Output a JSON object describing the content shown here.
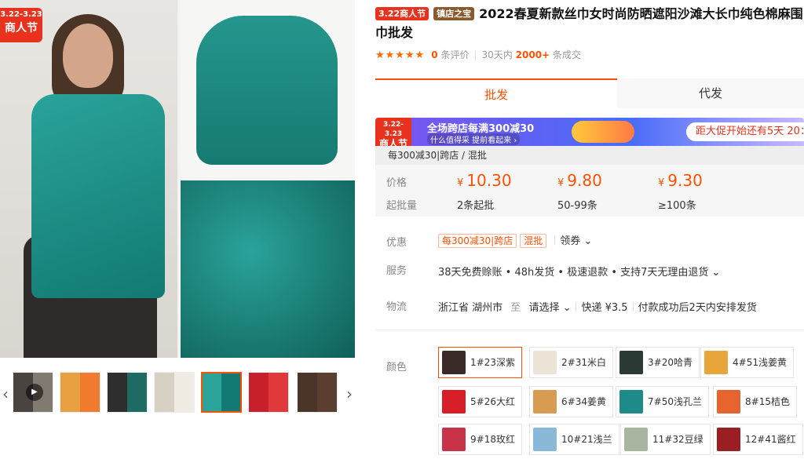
{
  "gallery": {
    "badge_date": "3.22-3.23",
    "badge_name": "商人节",
    "thumbs": [
      {
        "icon": "video-play-icon",
        "colors": [
          "#4a4440",
          "#807a70"
        ]
      },
      {
        "colors": [
          "#e8a040",
          "#f07a2e"
        ]
      },
      {
        "colors": [
          "#2e2e2e",
          "#1d6b63"
        ]
      },
      {
        "colors": [
          "#d8d0c2",
          "#f0ece4"
        ]
      },
      {
        "colors": [
          "#2aa39a",
          "#127a72"
        ]
      },
      {
        "colors": [
          "#c8202a",
          "#e23a3a"
        ]
      },
      {
        "colors": [
          "#4b3428",
          "#5a3e30"
        ]
      }
    ],
    "prev_arrow": "‹",
    "next_arrow": "›",
    "play_glyph": "▶"
  },
  "product": {
    "tag_festival": "3.22商人节",
    "tag_store": "镇店之宝",
    "title": "2022春夏新款丝巾女时尚防晒遮阳沙滩大长巾纯色棉麻围巾批发",
    "stars": "★★★★★",
    "reviews_count": "0",
    "reviews_label": "条评价",
    "period_label": "30天内",
    "sales_count": "2000+",
    "sales_label": "条成交"
  },
  "tabs": {
    "wholesale": "批发",
    "dropship": "代发"
  },
  "promo": {
    "badge_date": "3.22-3.23",
    "badge_name": "商人节",
    "headline": "全场跨店每满300减30",
    "subline": "什么值得采 提前看起来 ›",
    "countdown": "距大促开始还有5天 20：",
    "rule": "每300减30|跨店 / 混批"
  },
  "pricing": {
    "price_label": "价格",
    "qty_label": "起批量",
    "currency": "¥",
    "tiers": [
      {
        "price": "10.30",
        "qty": "2条起批"
      },
      {
        "price": "9.80",
        "qty": "50-99条"
      },
      {
        "price": "9.30",
        "qty": "≥100条"
      }
    ]
  },
  "offers": {
    "label": "优惠",
    "chip1": "每300减30|跨店",
    "chip2": "混批",
    "coupon": "领券 ⌄"
  },
  "service": {
    "label": "服务",
    "text": "38天免费赊账 • 48h发货 • 极速退款 • 支持7天无理由退货 ⌄"
  },
  "logistics": {
    "label": "物流",
    "origin": "浙江省 湖州市",
    "to": "至",
    "dest": "请选择 ⌄",
    "express": "快递 ¥3.5",
    "ship_note": "付款成功后2天内安排发货"
  },
  "colors": {
    "label": "颜色",
    "options": [
      {
        "name": "1#23深紫",
        "swatch": "#3a2a28",
        "selected": true
      },
      {
        "name": "2#31米白",
        "swatch": "#ece4d6"
      },
      {
        "name": "3#20哈青",
        "swatch": "#2c3a36"
      },
      {
        "name": "4#51浅姜黄",
        "swatch": "#e8a53a"
      },
      {
        "name": "5#26大红",
        "swatch": "#d81e26"
      },
      {
        "name": "6#34姜黄",
        "swatch": "#d99a52"
      },
      {
        "name": "7#50浅孔兰",
        "swatch": "#1f8a8a"
      },
      {
        "name": "8#15桔色",
        "swatch": "#e8642e"
      },
      {
        "name": "9#18玫红",
        "swatch": "#c8334a"
      },
      {
        "name": "10#21浅兰",
        "swatch": "#8ab8d8"
      },
      {
        "name": "11#32豆绿",
        "swatch": "#a8b6a0"
      },
      {
        "name": "12#41酱红",
        "swatch": "#9a1e22"
      }
    ]
  }
}
